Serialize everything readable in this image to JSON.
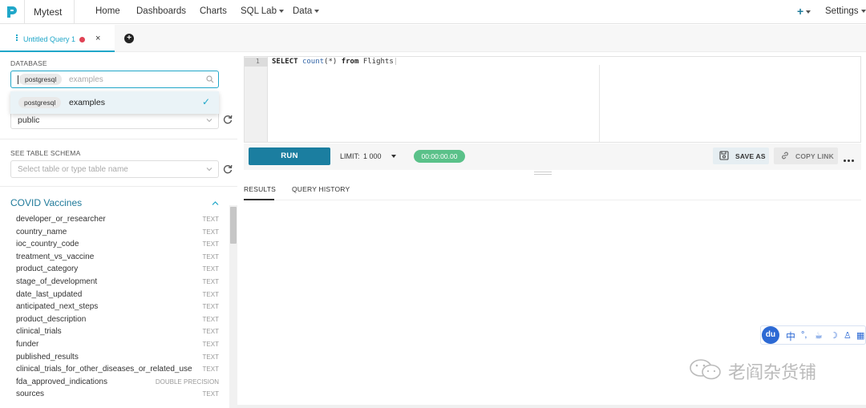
{
  "app": {
    "name": "Mytest",
    "brand_color": "#20a7c9"
  },
  "nav": {
    "items": [
      {
        "label": "Home"
      },
      {
        "label": "Dashboards"
      },
      {
        "label": "Charts"
      },
      {
        "label": "SQL Lab"
      },
      {
        "label": "Data"
      }
    ],
    "plus": "+",
    "settings": "Settings"
  },
  "tabs": {
    "active_label": "Untitled Query 1",
    "close": "×",
    "add": "+"
  },
  "sidebar": {
    "database_label": "DATABASE",
    "database_pill": "postgresql",
    "database_placeholder": "examples",
    "dropdown_option_pill": "postgresql",
    "dropdown_option_label": "examples",
    "schema_value": "public",
    "see_table_schema_label": "SEE TABLE SCHEMA",
    "table_placeholder": "Select table or type table name",
    "table_title": "COVID Vaccines",
    "columns": [
      {
        "name": "developer_or_researcher",
        "type": "TEXT"
      },
      {
        "name": "country_name",
        "type": "TEXT"
      },
      {
        "name": "ioc_country_code",
        "type": "TEXT"
      },
      {
        "name": "treatment_vs_vaccine",
        "type": "TEXT"
      },
      {
        "name": "product_category",
        "type": "TEXT"
      },
      {
        "name": "stage_of_development",
        "type": "TEXT"
      },
      {
        "name": "date_last_updated",
        "type": "TEXT"
      },
      {
        "name": "anticipated_next_steps",
        "type": "TEXT"
      },
      {
        "name": "product_description",
        "type": "TEXT"
      },
      {
        "name": "clinical_trials",
        "type": "TEXT"
      },
      {
        "name": "funder",
        "type": "TEXT"
      },
      {
        "name": "published_results",
        "type": "TEXT"
      },
      {
        "name": "clinical_trials_for_other_diseases_or_related_use",
        "type": "TEXT"
      },
      {
        "name": "fda_approved_indications",
        "type": "DOUBLE PRECISION"
      },
      {
        "name": "sources",
        "type": "TEXT"
      }
    ]
  },
  "editor": {
    "line_number": "1",
    "tokens": {
      "select": "SELECT",
      "count": "count",
      "star": "(*)",
      "from": "from",
      "table": "Flights"
    }
  },
  "toolbar": {
    "run": "RUN",
    "limit_label": "LIMIT:",
    "limit_value": "1 000",
    "timer": "00:00:00.00",
    "save_as": "SAVE AS",
    "copy_link": "COPY LINK"
  },
  "results": {
    "tab_results": "RESULTS",
    "tab_history": "QUERY HISTORY"
  },
  "ime": {
    "du": "du",
    "zh": "中",
    "icons": [
      "°,",
      "☕",
      "☽",
      "♙",
      "▦"
    ]
  },
  "watermark": {
    "text": "老阎杂货铺"
  }
}
